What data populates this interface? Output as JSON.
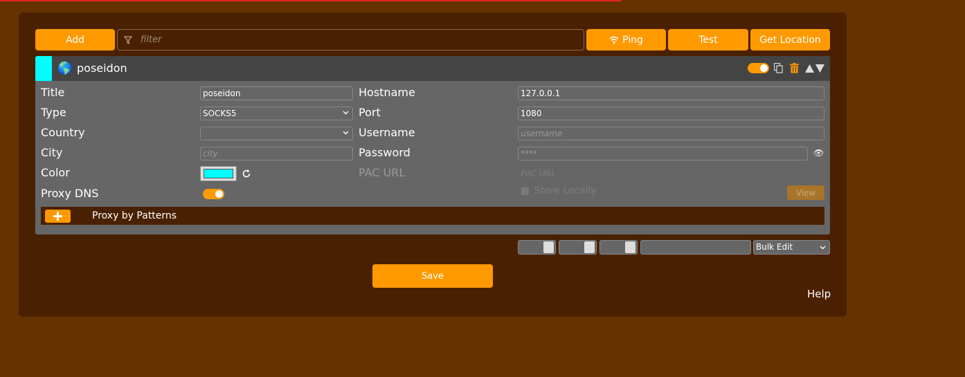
{
  "toolbar": {
    "add_label": "Add",
    "filter_placeholder": "filter",
    "ping_label": "Ping",
    "test_label": "Test",
    "location_label": "Get Location"
  },
  "proxy": {
    "header_title": "poseidon",
    "color": "#00ffff",
    "enabled": true,
    "fields": {
      "title_label": "Title",
      "title_value": "poseidon",
      "type_label": "Type",
      "type_value": "SOCKS5",
      "country_label": "Country",
      "country_value": "",
      "city_label": "City",
      "city_placeholder": "city",
      "color_label": "Color",
      "proxy_dns_label": "Proxy DNS",
      "proxy_dns_enabled": true,
      "hostname_label": "Hostname",
      "hostname_value": "127.0.0.1",
      "port_label": "Port",
      "port_value": "1080",
      "username_label": "Username",
      "username_placeholder": "username",
      "password_label": "Password",
      "password_placeholder": "****",
      "pac_url_label": "PAC URL",
      "pac_url_placeholder": "PAC URL",
      "store_locally_label": "Store Locally",
      "view_label": "View"
    },
    "patterns_label": "Proxy by Patterns"
  },
  "bulk": {
    "select_value": "Bulk Edit"
  },
  "save_label": "Save",
  "help_label": "Help",
  "colors": {
    "accent": "#ff9900",
    "background": "#663300",
    "panel": "#4a2100",
    "proxy_color": "#00ffff"
  }
}
